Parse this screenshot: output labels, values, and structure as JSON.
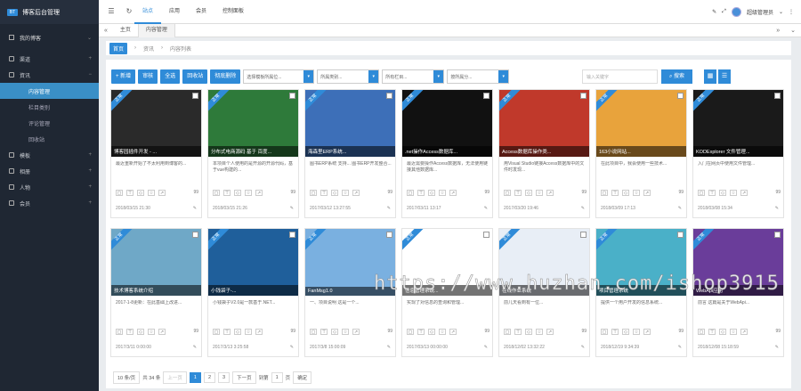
{
  "app": {
    "logo_text": "博客后台管理",
    "logo_badge": "BT"
  },
  "user": {
    "name": "我的博客"
  },
  "sidebar": {
    "items": [
      {
        "label": "渠道",
        "icon": "file-icon"
      },
      {
        "label": "資讯",
        "icon": "list-icon"
      },
      {
        "label": "内容管理",
        "active": true
      },
      {
        "label": "栏目类别"
      },
      {
        "label": "评论管理"
      },
      {
        "label": "回收站"
      },
      {
        "label": "模板",
        "icon": "grid-icon"
      },
      {
        "label": "相册",
        "icon": "image-icon"
      },
      {
        "label": "人物",
        "icon": "user-icon"
      },
      {
        "label": "会员",
        "icon": "users-icon"
      }
    ]
  },
  "topbar": {
    "nav": [
      "站点",
      "应用",
      "会员",
      "控制面板"
    ],
    "user_label": "超级管理员"
  },
  "tabs": {
    "home": "主页",
    "current": "内容管理"
  },
  "breadcrumb": {
    "home": "首页",
    "level1": "资讯",
    "level2": "内容列表"
  },
  "toolbar": {
    "add": "+ 新增",
    "audit": "审核",
    "select_all": "全选",
    "recycle": "回收站",
    "delete": "彻底删除",
    "filter1": "选择模板所属位...",
    "filter2": "所属类别...",
    "filter3": "所有栏目...",
    "filter4": "按所属分...",
    "search_placeholder": "输入关键字",
    "search_btn": "搜索"
  },
  "cards": [
    {
      "title": "博客园插件开发 - ...",
      "desc": "最近重新开始了不太利用到博客的...",
      "date": "2018/03/15 21:30",
      "views": "99",
      "bg": "#2a2a2a"
    },
    {
      "title": "分布式电商源码 基于 百度...",
      "desc": "本项目个人使用的是开源的开源代码，基于vue构建的...",
      "date": "2018/03/15 21:26",
      "views": "99",
      "bg": "#2e7a3a"
    },
    {
      "title": "海森里ERP系统...",
      "desc": "图书ERP系统 支持... 图书ERP开发整合...",
      "date": "2017/03/12 13:27:55",
      "views": "99",
      "bg": "#3d6fb8"
    },
    {
      "title": ".net操作Access数据库...",
      "desc": "最近需要操作Access数据库，无法使用链接其他数据库...",
      "date": "2017/03/11 13:17",
      "views": "99",
      "bg": "#111111"
    },
    {
      "title": "Access数据库操作类...",
      "desc": "用Visual Studio链接Access数据库中的文件时发现...",
      "date": "2017/03/20 19:46",
      "views": "99",
      "bg": "#c0392b"
    },
    {
      "title": "163小说网站...",
      "desc": "在此项目中，我会使用一些技术...",
      "date": "2018/03/09 17:13",
      "views": "99",
      "bg": "#e8a33c"
    },
    {
      "title": "KODExplorer 文件管理...",
      "desc": "入门在网页中使用文件管理...",
      "date": "2018/03/08 15:34",
      "views": "99",
      "bg": "#1a1a1a"
    },
    {
      "title": "技术博客系统介绍",
      "desc": "2017-1-8更新：在此基础上改进...",
      "date": "2017/3/11 0:00:00",
      "views": "99",
      "bg": "#6fa8c7"
    },
    {
      "title": "小钱袋子-...",
      "desc": "小钱袋子V2.0是一款基于.NET...",
      "date": "2017/3/13 3:25:58",
      "views": "99",
      "bg": "#1f5f9b"
    },
    {
      "title": "FanMsg1.0",
      "desc": "一、项目说明 这是一个...",
      "date": "2017/3/8 15:00:09",
      "views": "99",
      "bg": "#7ab0e0"
    },
    {
      "title": "信息管理系统...",
      "desc": "实现了对信息的查询和管理...",
      "date": "2017/03/13 00:00:00",
      "views": "99",
      "bg": "#ffffff"
    },
    {
      "title": "在线作业系统",
      "desc": "前几天看到有一位...",
      "date": "2018/12/02 13:32:22",
      "views": "99",
      "bg": "#e8eef6"
    },
    {
      "title": "项目管理系统",
      "desc": "提供一个用户开发的信息系统...",
      "date": "2018/12/19 9:34:39",
      "views": "99",
      "bg": "#4ab0c8"
    },
    {
      "title": "WebApi应用",
      "desc": "前言 这篇是关于WebApi...",
      "date": "2018/12/08 15:18:59",
      "views": "99",
      "bg": "#6a3d9a"
    }
  ],
  "pager": {
    "size": "10 条/页",
    "total": "共 34 条",
    "prev": "上一页",
    "pages": [
      "1",
      "2",
      "3"
    ],
    "next": "下一页",
    "goto": "到第",
    "goto_value": "1",
    "page_unit": "页",
    "confirm": "确定"
  },
  "watermark": "https://www.huzhan.com/ishop3915"
}
